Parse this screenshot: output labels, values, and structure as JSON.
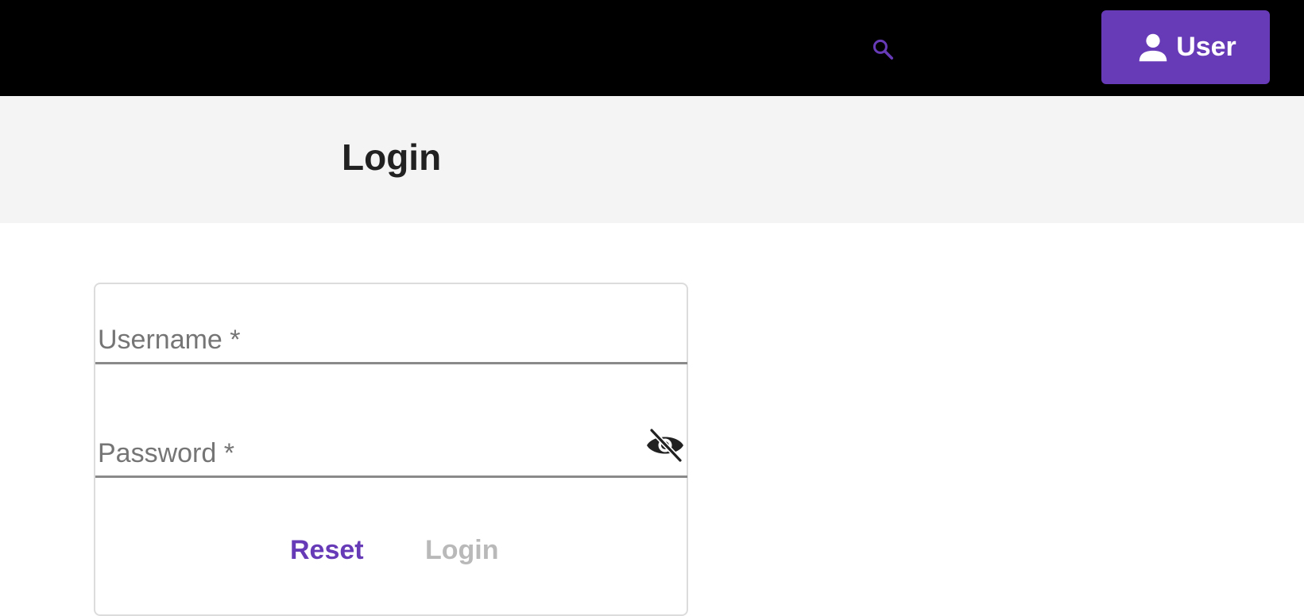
{
  "colors": {
    "topbar": "#000000",
    "accent": "#673ab7",
    "header_bg": "#f4f4f4",
    "disabled_text": "#b9b9b9"
  },
  "topbar": {
    "search_icon": "search-icon",
    "user_button": {
      "icon": "person-icon",
      "label": "User"
    }
  },
  "page": {
    "title": "Login"
  },
  "form": {
    "username": {
      "label": "Username *"
    },
    "password": {
      "label": "Password *",
      "toggle_icon": "eye-off-icon"
    },
    "actions": {
      "reset_label": "Reset",
      "login_label": "Login",
      "login_disabled": true
    }
  }
}
